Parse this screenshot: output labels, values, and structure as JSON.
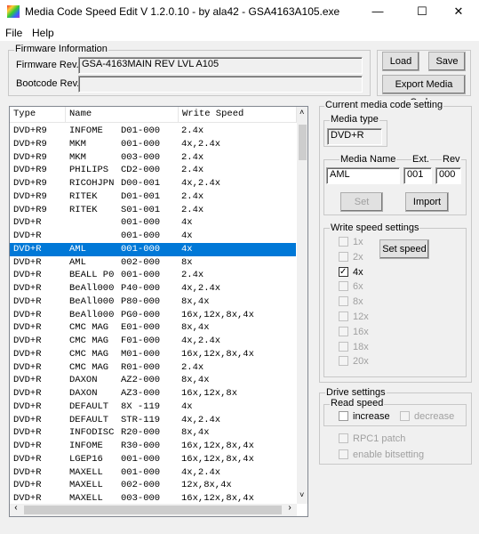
{
  "window": {
    "title": "Media Code Speed Edit V 1.2.0.10 - by ala42 - GSA4163A105.exe",
    "minimize": "—",
    "maximize": "☐",
    "close": "✕"
  },
  "menu": [
    "File",
    "Help"
  ],
  "firmware": {
    "group_label": "Firmware Information",
    "fw_label": "Firmware Rev.",
    "fw_value": "GSA-4163MAIN    REV LVL A105",
    "boot_label": "Bootcode Rev.",
    "boot_value": ""
  },
  "buttons": {
    "load": "Load",
    "save": "Save",
    "export": "Export Media Codes",
    "set": "Set",
    "import": "Import",
    "set_speed": "Set speed"
  },
  "table": {
    "headers": [
      "Type",
      "Name",
      "Write Speed"
    ],
    "selected_index": 9,
    "rows": [
      [
        "DVD+R9",
        "INFOME",
        "D01-000",
        "2.4x"
      ],
      [
        "DVD+R9",
        "MKM",
        "001-000",
        "4x,2.4x"
      ],
      [
        "DVD+R9",
        "MKM",
        "003-000",
        "2.4x"
      ],
      [
        "DVD+R9",
        "PHILIPS",
        "CD2-000",
        "2.4x"
      ],
      [
        "DVD+R9",
        "RICOHJPN",
        "D00-001",
        "4x,2.4x"
      ],
      [
        "DVD+R9",
        "RITEK",
        "D01-001",
        "2.4x"
      ],
      [
        "DVD+R9",
        "RITEK",
        "S01-001",
        "2.4x"
      ],
      [
        "DVD+R",
        "",
        "001-000",
        "4x"
      ],
      [
        "DVD+R",
        "",
        "001-000",
        "4x"
      ],
      [
        "DVD+R",
        "AML",
        "001-000",
        "4x"
      ],
      [
        "DVD+R",
        "AML",
        "002-000",
        "8x"
      ],
      [
        "DVD+R",
        "BEALL P0",
        "001-000",
        "2.4x"
      ],
      [
        "DVD+R",
        "BeAll000",
        "P40-000",
        "4x,2.4x"
      ],
      [
        "DVD+R",
        "BeAll000",
        "P80-000",
        "8x,4x"
      ],
      [
        "DVD+R",
        "BeAll000",
        "PG0-000",
        "16x,12x,8x,4x"
      ],
      [
        "DVD+R",
        "CMC MAG",
        "E01-000",
        "8x,4x"
      ],
      [
        "DVD+R",
        "CMC MAG",
        "F01-000",
        "4x,2.4x"
      ],
      [
        "DVD+R",
        "CMC MAG",
        "M01-000",
        "16x,12x,8x,4x"
      ],
      [
        "DVD+R",
        "CMC MAG",
        "R01-000",
        "2.4x"
      ],
      [
        "DVD+R",
        "DAXON",
        "AZ2-000",
        "8x,4x"
      ],
      [
        "DVD+R",
        "DAXON",
        "AZ3-000",
        "16x,12x,8x"
      ],
      [
        "DVD+R",
        "DEFAULT",
        "8X -119",
        "4x"
      ],
      [
        "DVD+R",
        "DEFAULT",
        "STR-119",
        "4x,2.4x"
      ],
      [
        "DVD+R",
        "INFODISC",
        "R20-000",
        "8x,4x"
      ],
      [
        "DVD+R",
        "INFOME",
        "R30-000",
        "16x,12x,8x,4x"
      ],
      [
        "DVD+R",
        "LGEP16",
        "001-000",
        "16x,12x,8x,4x"
      ],
      [
        "DVD+R",
        "MAXELL",
        "001-000",
        "4x,2.4x"
      ],
      [
        "DVD+R",
        "MAXELL",
        "002-000",
        "12x,8x,4x"
      ],
      [
        "DVD+R",
        "MAXELL",
        "003-000",
        "16x,12x,8x,4x"
      ]
    ]
  },
  "current": {
    "group_label": "Current media code setting",
    "media_type_label": "Media type",
    "media_type": "DVD+R",
    "name_label": "Media Name",
    "ext_label": "Ext.",
    "rev_label": "Rev",
    "name": "AML",
    "ext": "001",
    "rev": "000"
  },
  "write_speed": {
    "group_label": "Write speed settings",
    "options": [
      {
        "label": "1x",
        "checked": false,
        "enabled": false
      },
      {
        "label": "2x",
        "checked": false,
        "enabled": false
      },
      {
        "label": "4x",
        "checked": true,
        "enabled": true
      },
      {
        "label": "6x",
        "checked": false,
        "enabled": false
      },
      {
        "label": "8x",
        "checked": false,
        "enabled": false
      },
      {
        "label": "12x",
        "checked": false,
        "enabled": false
      },
      {
        "label": "16x",
        "checked": false,
        "enabled": false
      },
      {
        "label": "18x",
        "checked": false,
        "enabled": false
      },
      {
        "label": "20x",
        "checked": false,
        "enabled": false
      }
    ]
  },
  "drive": {
    "group_label": "Drive settings",
    "read_label": "Read speed",
    "increase": "increase",
    "decrease": "decrease",
    "rpc1": "RPC1 patch",
    "bitsetting": "enable bitsetting"
  },
  "accent": "#0078d7"
}
